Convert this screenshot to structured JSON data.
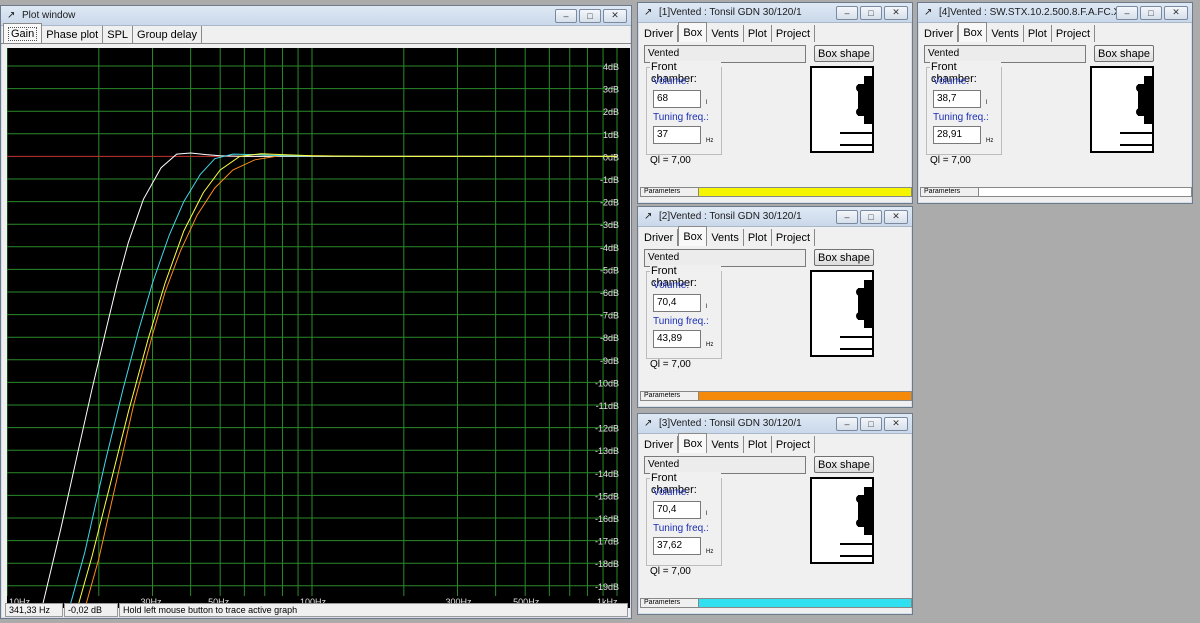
{
  "plot_window": {
    "title": "Plot window",
    "tabs": [
      "Gain",
      "Phase plot",
      "SPL",
      "Group delay"
    ],
    "status": {
      "freq": "341,33 Hz",
      "gain": "-0,02 dB",
      "hint": "Hold left mouse button to trace active graph"
    },
    "x_ticks": [
      "10Hz",
      "30Hz",
      "50Hz",
      "100Hz",
      "300Hz",
      "500Hz",
      "1kHz"
    ],
    "y_ticks": [
      "4dB",
      "3dB",
      "2dB",
      "1dB",
      "0dB",
      "-1dB",
      "-2dB",
      "-3dB",
      "-4dB",
      "-5dB",
      "-6dB",
      "-7dB",
      "-8dB",
      "-9dB",
      "-10dB",
      "-11dB",
      "-12dB",
      "-13dB",
      "-14dB",
      "-15dB",
      "-16dB",
      "-17dB",
      "-18dB",
      "-19dB"
    ],
    "colors": {
      "grid": "#2a8a2a",
      "zero_line": "#c83232",
      "background": "#000000"
    }
  },
  "chart_data": {
    "type": "line",
    "xscale": "log",
    "xlim": [
      10,
      1000
    ],
    "ylim": [
      -20,
      5
    ],
    "series": [
      {
        "color": "#ffffff",
        "x": [
          13,
          15,
          17,
          19,
          21,
          23,
          25,
          28,
          32,
          36,
          40,
          45,
          50,
          60
        ],
        "y": [
          -20,
          -16.5,
          -13.2,
          -10.3,
          -7.8,
          -5.6,
          -3.8,
          -1.9,
          -0.5,
          0.1,
          0.15,
          0.08,
          0.03,
          0
        ]
      },
      {
        "color": "#ff8c1a",
        "x": [
          18,
          20,
          23,
          26,
          30,
          33,
          37,
          42,
          48,
          55,
          65,
          80,
          100,
          150
        ],
        "y": [
          -20,
          -17.8,
          -14.2,
          -11,
          -7.9,
          -6,
          -4.2,
          -2.6,
          -1.4,
          -0.6,
          -0.15,
          0.05,
          0.03,
          0
        ]
      },
      {
        "color": "#40d8e8",
        "x": [
          16,
          18,
          21,
          24,
          27,
          30,
          34,
          38,
          43,
          48,
          55,
          65,
          80,
          150
        ],
        "y": [
          -20,
          -17.5,
          -13.5,
          -10.3,
          -7.7,
          -5.6,
          -3.5,
          -2,
          -0.8,
          -0.1,
          0.1,
          0.08,
          0.03,
          0
        ]
      },
      {
        "color": "#ffff40",
        "x": [
          17,
          19,
          22,
          25,
          29,
          33,
          38,
          44,
          50,
          58,
          68,
          80,
          100,
          150
        ],
        "y": [
          -20,
          -17.7,
          -14.3,
          -11.3,
          -8.1,
          -5.6,
          -3.3,
          -1.6,
          -0.6,
          0,
          0.12,
          0.08,
          0.03,
          0
        ]
      }
    ]
  },
  "box_windows": [
    {
      "title": "[1]Vented : Tonsil GDN 30/120/1",
      "tabs": [
        "Driver",
        "Box",
        "Vents",
        "Plot",
        "Project"
      ],
      "box_type": "Vented",
      "box_shape_label": "Box shape",
      "group_label": "Front chamber:",
      "volume_label": "Volume:",
      "volume_value": "68",
      "volume_unit": "l",
      "tuning_label": "Tuning freq.:",
      "tuning_value": "37",
      "tuning_unit": "Hz",
      "ql": "Ql = 7,00",
      "params_label": "Parameters",
      "color": "#f5f500"
    },
    {
      "title": "[2]Vented : Tonsil GDN 30/120/1",
      "tabs": [
        "Driver",
        "Box",
        "Vents",
        "Plot",
        "Project"
      ],
      "box_type": "Vented",
      "box_shape_label": "Box shape",
      "group_label": "Front chamber:",
      "volume_label": "Volume:",
      "volume_value": "70,4",
      "volume_unit": "l",
      "tuning_label": "Tuning freq.:",
      "tuning_value": "43,89",
      "tuning_unit": "Hz",
      "ql": "Ql = 7,00",
      "params_label": "Parameters",
      "color": "#f58a0a"
    },
    {
      "title": "[3]Vented : Tonsil GDN 30/120/1",
      "tabs": [
        "Driver",
        "Box",
        "Vents",
        "Plot",
        "Project"
      ],
      "box_type": "Vented",
      "box_shape_label": "Box shape",
      "group_label": "Front chamber:",
      "volume_label": "Volume:",
      "volume_value": "70,4",
      "volume_unit": "l",
      "tuning_label": "Tuning freq.:",
      "tuning_value": "37,62",
      "tuning_unit": "Hz",
      "ql": "Ql = 7,00",
      "params_label": "Parameters",
      "color": "#30e0f0"
    },
    {
      "title": "[4]Vented : SW.STX.10.2.500.8.F.A.FC.X",
      "tabs": [
        "Driver",
        "Box",
        "Vents",
        "Plot",
        "Project"
      ],
      "box_type": "Vented",
      "box_shape_label": "Box shape",
      "group_label": "Front chamber:",
      "volume_label": "Volume:",
      "volume_value": "38,7",
      "volume_unit": "l",
      "tuning_label": "Tuning freq.:",
      "tuning_value": "28,91",
      "tuning_unit": "Hz",
      "ql": "Ql = 7,00",
      "params_label": "Parameters",
      "color": "#ffffff"
    }
  ]
}
